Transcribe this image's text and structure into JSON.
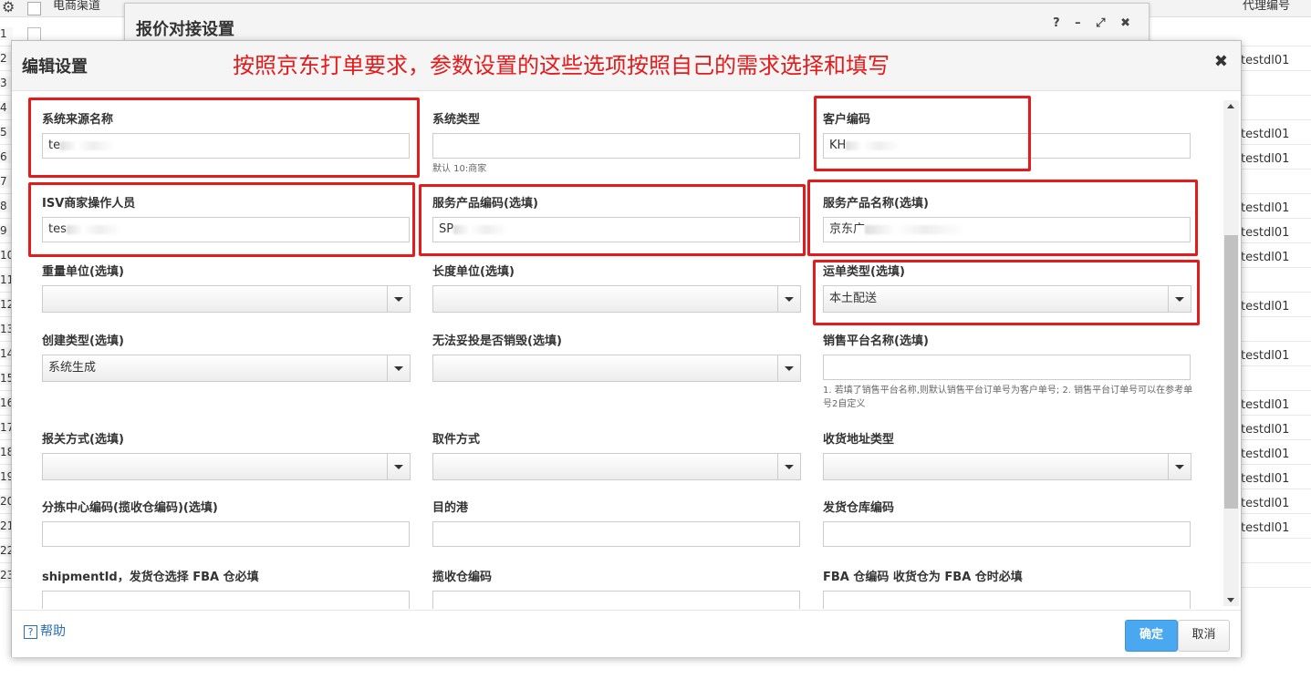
{
  "background": {
    "headers": [
      "电商渠道",
      "代理编号"
    ],
    "row_numbers": [
      "1",
      "2",
      "3",
      "4",
      "5",
      "6",
      "7",
      "8",
      "9",
      "10",
      "11",
      "12",
      "13",
      "14",
      "15",
      "16",
      "17",
      "18",
      "19",
      "20",
      "21",
      "22",
      "23"
    ],
    "agent_cells": [
      "testdl01",
      "testdl01",
      "testdl01",
      "testdl01",
      "testdl01",
      "testdl01",
      "testdl01",
      "testdl01",
      "testdl01",
      "testdl01",
      "testdl01",
      "testdl01",
      "testdl01",
      "testdl01"
    ]
  },
  "back_dialog": {
    "title": "报价对接设置",
    "controls": "? – ⤢ ✖"
  },
  "dialog": {
    "title": "编辑设置",
    "annotation": "按照京东打单要求，参数设置的这些选项按照自己的需求选择和填写",
    "close": "✖",
    "fields": {
      "sys_source": {
        "label": "系统来源名称",
        "value": "te"
      },
      "sys_type": {
        "label": "系统类型",
        "value": "",
        "hint": "默认 10:商家"
      },
      "customer_code": {
        "label": "客户编码",
        "value": "KH"
      },
      "isv_operator": {
        "label": "ISV商家操作人员",
        "value": "tes"
      },
      "service_code": {
        "label": "服务产品编码(选填)",
        "value": "SP"
      },
      "service_name": {
        "label": "服务产品名称(选填)",
        "value": "京东广"
      },
      "weight_unit": {
        "label": "重量单位(选填)",
        "value": ""
      },
      "length_unit": {
        "label": "长度单位(选填)",
        "value": ""
      },
      "waybill_type": {
        "label": "运单类型(选填)",
        "value": "本土配送"
      },
      "create_type": {
        "label": "创建类型(选填)",
        "value": "系统生成"
      },
      "undeliverable": {
        "label": "无法妥投是否销毁(选填)",
        "value": ""
      },
      "platform_name": {
        "label": "销售平台名称(选填)",
        "value": "",
        "hint": "1. 若填了销售平台名称,则默认销售平台订单号为客户单号; 2. 销售平台订单号可以在参考单号2自定义"
      },
      "customs": {
        "label": "报关方式(选填)",
        "value": ""
      },
      "pickup": {
        "label": "取件方式",
        "value": ""
      },
      "address_type": {
        "label": "收货地址类型",
        "value": ""
      },
      "sort_center": {
        "label": "分拣中心编码(揽收仓编码)(选填)",
        "value": ""
      },
      "dest_port": {
        "label": "目的港",
        "value": ""
      },
      "ship_warehouse": {
        "label": "发货仓库编码",
        "value": ""
      },
      "shipment_id": {
        "label": "shipmentId，发货仓选择 FBA 仓必填",
        "value": ""
      },
      "collect_warehouse": {
        "label": "揽收仓编码",
        "value": ""
      },
      "fba_warehouse": {
        "label": "FBA 仓编码 收货仓为 FBA 仓时必填",
        "value": ""
      }
    },
    "footer": {
      "help": "帮助",
      "help_icon": "?",
      "ok": "确定",
      "cancel": "取消"
    }
  }
}
